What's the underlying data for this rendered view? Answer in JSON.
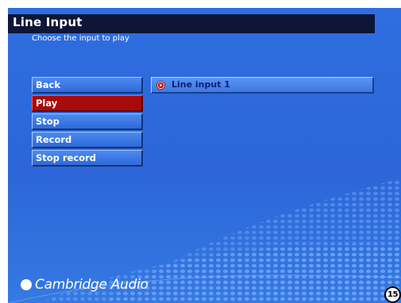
{
  "header": {
    "title": "Line Input",
    "subtitle": "Choose the input to play"
  },
  "menu": {
    "items": [
      {
        "label": "Back",
        "selected": false
      },
      {
        "label": "Play",
        "selected": true
      },
      {
        "label": "Stop",
        "selected": false
      },
      {
        "label": "Record",
        "selected": false
      },
      {
        "label": "Stop record",
        "selected": false
      }
    ]
  },
  "source": {
    "label": "Line input 1",
    "icon": "play-circle-icon"
  },
  "brand": {
    "name": "Cambridge Audio",
    "icon": "circle-logo-icon"
  },
  "page_number": "15",
  "colors": {
    "background": "#2c66d8",
    "title_bar": "#0d1636",
    "selected_item": "#a80a0a",
    "source_text": "#0c1f7a"
  }
}
